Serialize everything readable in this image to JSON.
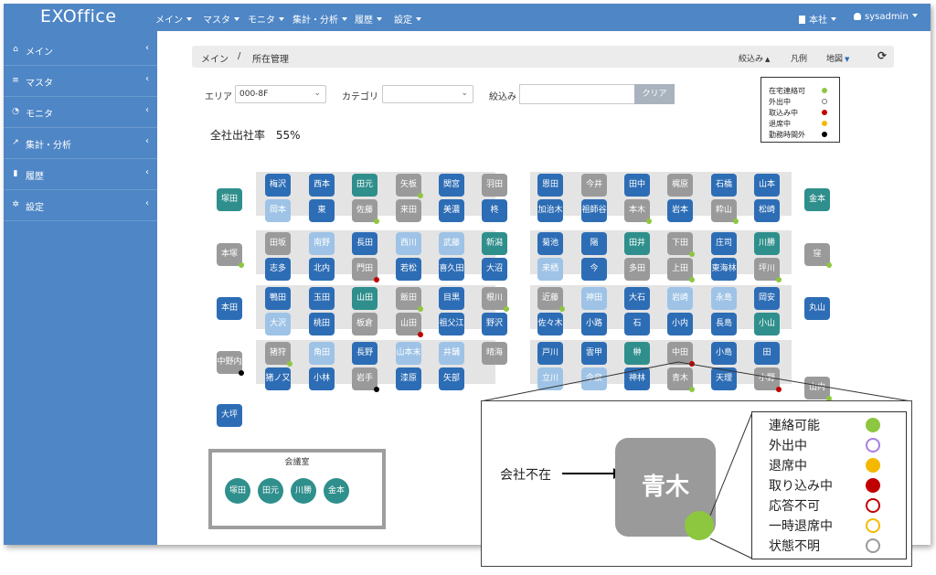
{
  "app": {
    "brand": "EXOffice"
  },
  "topnav": {
    "items": [
      "メイン",
      "マスタ",
      "モニタ",
      "集計・分析",
      "履歴",
      "設定"
    ],
    "office": "本社",
    "user": "sysadmin"
  },
  "sidebar": {
    "items": [
      {
        "label": "メイン",
        "icon": "home-icon"
      },
      {
        "label": "マスタ",
        "icon": "database-icon"
      },
      {
        "label": "モニタ",
        "icon": "dashboard-icon"
      },
      {
        "label": "集計・分析",
        "icon": "chart-icon"
      },
      {
        "label": "履歴",
        "icon": "clipboard-icon"
      },
      {
        "label": "設定",
        "icon": "gear-icon"
      }
    ]
  },
  "breadcrumb": {
    "root": "メイン",
    "sep": "/",
    "current": "所在管理",
    "narrow": "絞込み",
    "legend": "凡例",
    "map": "地図"
  },
  "filters": {
    "area_label": "エリア",
    "area_value": "000-8F",
    "category_label": "カテゴリ",
    "category_value": "",
    "search_label": "絞込み",
    "search_value": "",
    "clear": "クリア"
  },
  "stats": {
    "label": "全社出社率",
    "value": "55%"
  },
  "legend_small": [
    {
      "label": "在宅連絡可",
      "color": "#8dc63f",
      "style": "fill"
    },
    {
      "label": "外出中",
      "color": "#777777",
      "style": "ring"
    },
    {
      "label": "取込み中",
      "color": "#c00000",
      "style": "fill"
    },
    {
      "label": "退席中",
      "color": "#f5b800",
      "style": "fill"
    },
    {
      "label": "勤務時間外",
      "color": "#000000",
      "style": "fill"
    }
  ],
  "colors": {
    "blue": "#2d6db5",
    "lightblue": "#9ec3e6",
    "teal": "#2f8f8c",
    "gray": "#9a9a9a",
    "green": "#8dc63f",
    "red": "#c00000",
    "black": "#000000"
  },
  "seats": [
    {
      "n": "塚田",
      "c": "teal"
    },
    {
      "n": "本塚",
      "c": "gray",
      "d": "green"
    },
    {
      "n": "本田",
      "c": "blue"
    },
    {
      "n": "中野内",
      "c": "gray",
      "d": "black"
    },
    {
      "n": "大坪",
      "c": "blue"
    },
    {
      "n": "梅沢",
      "c": "blue"
    },
    {
      "n": "岡本",
      "c": "lightblue"
    },
    {
      "n": "田坂",
      "c": "gray"
    },
    {
      "n": "志多",
      "c": "blue"
    },
    {
      "n": "鴨田",
      "c": "blue"
    },
    {
      "n": "大沢",
      "c": "lightblue"
    },
    {
      "n": "猪狩",
      "c": "gray",
      "d": "green"
    },
    {
      "n": "猪ノ又",
      "c": "blue"
    },
    {
      "n": "西本",
      "c": "blue"
    },
    {
      "n": "東",
      "c": "blue"
    },
    {
      "n": "南野",
      "c": "lightblue"
    },
    {
      "n": "北内",
      "c": "blue"
    },
    {
      "n": "玉田",
      "c": "blue"
    },
    {
      "n": "桃田",
      "c": "blue"
    },
    {
      "n": "角田",
      "c": "lightblue"
    },
    {
      "n": "小林",
      "c": "blue"
    },
    {
      "n": "田元",
      "c": "teal"
    },
    {
      "n": "佐藤",
      "c": "gray",
      "d": "green"
    },
    {
      "n": "長田",
      "c": "blue"
    },
    {
      "n": "門田",
      "c": "gray",
      "d": "red"
    },
    {
      "n": "山田",
      "c": "teal"
    },
    {
      "n": "板倉",
      "c": "gray"
    },
    {
      "n": "長野",
      "c": "blue"
    },
    {
      "n": "岩手",
      "c": "gray",
      "d": "black"
    },
    {
      "n": "矢板",
      "c": "gray",
      "d": "green"
    },
    {
      "n": "来田",
      "c": "gray"
    },
    {
      "n": "西川",
      "c": "lightblue"
    },
    {
      "n": "若松",
      "c": "blue"
    },
    {
      "n": "飯田",
      "c": "gray",
      "d": "green"
    },
    {
      "n": "山田",
      "c": "gray",
      "d": "red"
    },
    {
      "n": "山本末",
      "c": "lightblue"
    },
    {
      "n": "漆原",
      "c": "blue"
    },
    {
      "n": "関宮",
      "c": "blue"
    },
    {
      "n": "美濃",
      "c": "blue"
    },
    {
      "n": "武藤",
      "c": "lightblue"
    },
    {
      "n": "喜久田",
      "c": "blue"
    },
    {
      "n": "目黒",
      "c": "blue"
    },
    {
      "n": "祖父江",
      "c": "blue"
    },
    {
      "n": "井舗",
      "c": "lightblue"
    },
    {
      "n": "矢部",
      "c": "blue"
    },
    {
      "n": "羽田",
      "c": "gray"
    },
    {
      "n": "柊",
      "c": "blue"
    },
    {
      "n": "新潟",
      "c": "teal"
    },
    {
      "n": "大沼",
      "c": "blue"
    },
    {
      "n": "根川",
      "c": "gray",
      "d": "green"
    },
    {
      "n": "野沢",
      "c": "blue"
    },
    {
      "n": "晴海",
      "c": "gray"
    },
    {
      "n": "恩田",
      "c": "blue"
    },
    {
      "n": "加治木",
      "c": "blue"
    },
    {
      "n": "菊池",
      "c": "blue"
    },
    {
      "n": "来栖",
      "c": "lightblue"
    },
    {
      "n": "近藤",
      "c": "gray",
      "d": "green"
    },
    {
      "n": "佐々木",
      "c": "blue"
    },
    {
      "n": "戸川",
      "c": "blue"
    },
    {
      "n": "立川",
      "c": "lightblue"
    },
    {
      "n": "今井",
      "c": "gray"
    },
    {
      "n": "祖師谷",
      "c": "blue"
    },
    {
      "n": "陽",
      "c": "blue"
    },
    {
      "n": "今",
      "c": "blue"
    },
    {
      "n": "神田",
      "c": "lightblue"
    },
    {
      "n": "小路",
      "c": "blue"
    },
    {
      "n": "雲甲",
      "c": "blue"
    },
    {
      "n": "今泉",
      "c": "lightblue"
    },
    {
      "n": "田中",
      "c": "blue"
    },
    {
      "n": "本木",
      "c": "gray",
      "d": "green"
    },
    {
      "n": "田井",
      "c": "teal"
    },
    {
      "n": "多田",
      "c": "gray"
    },
    {
      "n": "大石",
      "c": "blue"
    },
    {
      "n": "石",
      "c": "blue"
    },
    {
      "n": "榊",
      "c": "teal"
    },
    {
      "n": "神林",
      "c": "blue"
    },
    {
      "n": "梶原",
      "c": "gray"
    },
    {
      "n": "岩本",
      "c": "blue"
    },
    {
      "n": "下田",
      "c": "gray",
      "d": "green"
    },
    {
      "n": "上田",
      "c": "gray",
      "d": "green"
    },
    {
      "n": "岩崎",
      "c": "lightblue"
    },
    {
      "n": "小内",
      "c": "blue"
    },
    {
      "n": "中田",
      "c": "gray",
      "d": "red"
    },
    {
      "n": "青木",
      "c": "gray",
      "d": "green"
    },
    {
      "n": "石橋",
      "c": "blue"
    },
    {
      "n": "粋山",
      "c": "gray",
      "d": "green"
    },
    {
      "n": "庄司",
      "c": "blue"
    },
    {
      "n": "東海林",
      "c": "blue"
    },
    {
      "n": "永島",
      "c": "lightblue"
    },
    {
      "n": "長島",
      "c": "blue"
    },
    {
      "n": "小島",
      "c": "blue"
    },
    {
      "n": "天理",
      "c": "blue"
    },
    {
      "n": "山本",
      "c": "blue"
    },
    {
      "n": "松崎",
      "c": "blue"
    },
    {
      "n": "川勝",
      "c": "teal"
    },
    {
      "n": "坪川",
      "c": "gray",
      "d": "green"
    },
    {
      "n": "岡安",
      "c": "blue"
    },
    {
      "n": "小山",
      "c": "teal"
    },
    {
      "n": "田",
      "c": "blue"
    },
    {
      "n": "小野",
      "c": "gray",
      "d": "red"
    },
    {
      "n": "金本",
      "c": "teal"
    },
    {
      "n": "窪",
      "c": "gray",
      "d": "green"
    },
    {
      "n": "丸山",
      "c": "blue"
    },
    {
      "n": "山内",
      "c": "gray",
      "d": "green"
    }
  ],
  "meeting": {
    "title": "会議室",
    "members": [
      "塚田",
      "田元",
      "川勝",
      "金本"
    ]
  },
  "callout": {
    "annotation": "会社不在",
    "seat_name": "青木",
    "legend": [
      {
        "label": "連絡可能",
        "color": "#8dc63f",
        "style": "fill"
      },
      {
        "label": "外出中",
        "color": "#a77fe0",
        "style": "ring"
      },
      {
        "label": "退席中",
        "color": "#f5b800",
        "style": "fill"
      },
      {
        "label": "取り込み中",
        "color": "#c00000",
        "style": "fill"
      },
      {
        "label": "応答不可",
        "color": "#c00000",
        "style": "ring"
      },
      {
        "label": "一時退席中",
        "color": "#f5b800",
        "style": "ring"
      },
      {
        "label": "状態不明",
        "color": "#999999",
        "style": "ring"
      }
    ]
  }
}
